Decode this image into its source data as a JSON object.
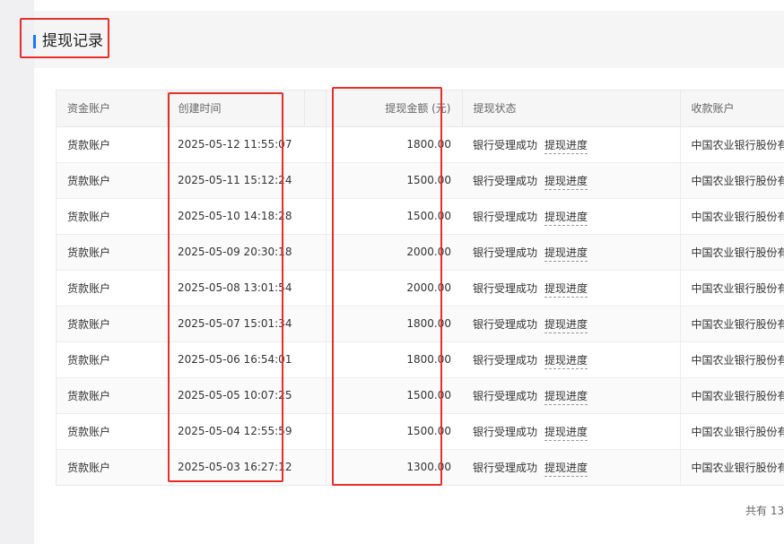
{
  "header": {
    "title": "提现记录"
  },
  "table": {
    "columns": {
      "account": "资金账户",
      "created_time": "创建时间",
      "amount": "提现金额 (元)",
      "status": "提现状态",
      "receiving_account": "收款账户"
    },
    "rows": [
      {
        "account": "货款账户",
        "time": "2025-05-12 11:55:07",
        "amount": "1800.00",
        "status": "银行受理成功",
        "progress": "提现进度",
        "bank": "中国农业银行股份有限公司"
      },
      {
        "account": "货款账户",
        "time": "2025-05-11 15:12:24",
        "amount": "1500.00",
        "status": "银行受理成功",
        "progress": "提现进度",
        "bank": "中国农业银行股份有限公司"
      },
      {
        "account": "货款账户",
        "time": "2025-05-10 14:18:28",
        "amount": "1500.00",
        "status": "银行受理成功",
        "progress": "提现进度",
        "bank": "中国农业银行股份有限公司"
      },
      {
        "account": "货款账户",
        "time": "2025-05-09 20:30:18",
        "amount": "2000.00",
        "status": "银行受理成功",
        "progress": "提现进度",
        "bank": "中国农业银行股份有限公司"
      },
      {
        "account": "货款账户",
        "time": "2025-05-08 13:01:54",
        "amount": "2000.00",
        "status": "银行受理成功",
        "progress": "提现进度",
        "bank": "中国农业银行股份有限公司"
      },
      {
        "account": "货款账户",
        "time": "2025-05-07 15:01:34",
        "amount": "1800.00",
        "status": "银行受理成功",
        "progress": "提现进度",
        "bank": "中国农业银行股份有限公司"
      },
      {
        "account": "货款账户",
        "time": "2025-05-06 16:54:01",
        "amount": "1800.00",
        "status": "银行受理成功",
        "progress": "提现进度",
        "bank": "中国农业银行股份有限公司"
      },
      {
        "account": "货款账户",
        "time": "2025-05-05 10:07:25",
        "amount": "1500.00",
        "status": "银行受理成功",
        "progress": "提现进度",
        "bank": "中国农业银行股份有限公司"
      },
      {
        "account": "货款账户",
        "time": "2025-05-04 12:55:59",
        "amount": "1500.00",
        "status": "银行受理成功",
        "progress": "提现进度",
        "bank": "中国农业银行股份有限公司"
      },
      {
        "account": "货款账户",
        "time": "2025-05-03 16:27:12",
        "amount": "1300.00",
        "status": "银行受理成功",
        "progress": "提现进度",
        "bank": "中国农业银行股份有限公司"
      }
    ]
  },
  "pagination": {
    "total_text": "共有 13"
  },
  "colors": {
    "accent": "#1677ff",
    "highlight": "#e5302a"
  }
}
